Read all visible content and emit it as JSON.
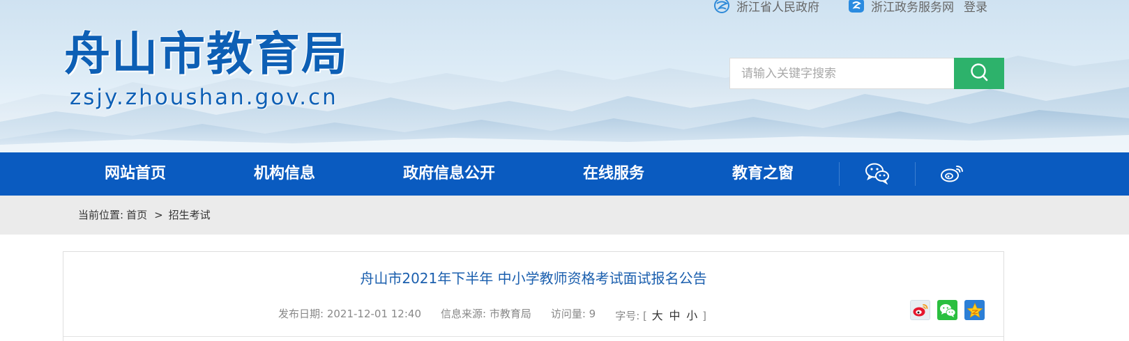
{
  "header": {
    "logo_cn": "舟山市教育局",
    "logo_en": "zsjy.zhoushan.gov.cn",
    "toplinks": [
      {
        "label": "浙江省人民政府",
        "icon": "zhejiang-gov-icon"
      },
      {
        "label": "浙江政务服务网",
        "icon": "zjzwfw-icon"
      }
    ],
    "login_label": "登录",
    "search": {
      "placeholder": "请输入关键字搜索",
      "value": "",
      "button_icon": "search-icon"
    }
  },
  "nav": {
    "items": [
      "网站首页",
      "机构信息",
      "政府信息公开",
      "在线服务",
      "教育之窗"
    ],
    "icons": [
      "wechat-icon",
      "weibo-icon"
    ]
  },
  "breadcrumb": {
    "prefix": "当前位置:",
    "home": "首页",
    "separator": ">",
    "current": "招生考试"
  },
  "article": {
    "title": "舟山市2021年下半年 中小学教师资格考试面试报名公告",
    "publish_date": "发布日期: 2021-12-01 12:40",
    "source": "信息来源: 市教育局",
    "views": "访问量: 9",
    "font_size_label": "字号: [",
    "font_size_large": "大",
    "font_size_medium": "中",
    "font_size_small": "小",
    "font_size_close": "]",
    "share_icons": [
      "weibo-share-icon",
      "wechat-share-icon",
      "qzone-share-icon"
    ]
  },
  "colors": {
    "nav_bg": "#0a5bc0",
    "search_button": "#2db26b",
    "title": "#1b5fae",
    "breadcrumb_bg": "#ebebeb"
  }
}
